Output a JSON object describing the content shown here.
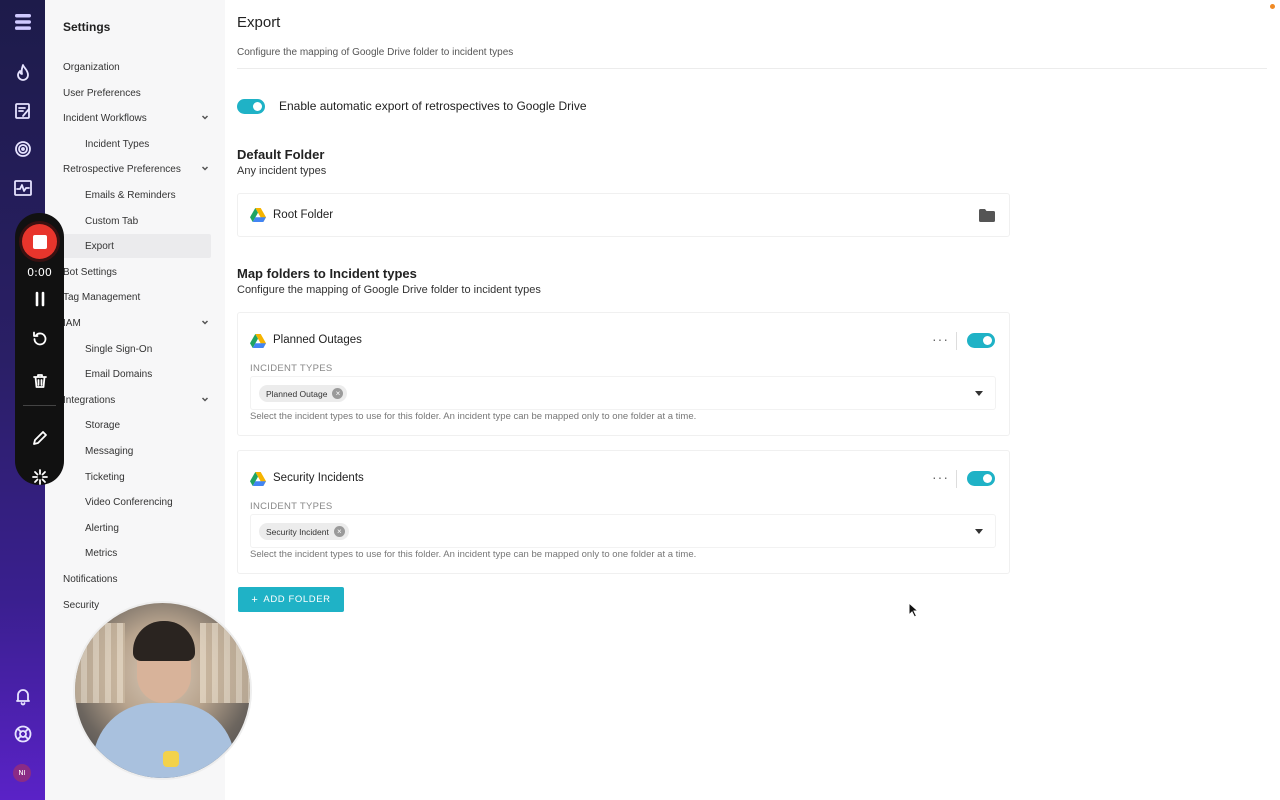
{
  "sidebar": {
    "title": "Settings",
    "items": [
      {
        "label": "Organization",
        "level": 1
      },
      {
        "label": "User Preferences",
        "level": 1
      },
      {
        "label": "Incident Workflows",
        "level": 1,
        "expanded": true
      },
      {
        "label": "Incident Types",
        "level": 2
      },
      {
        "label": "Retrospective Preferences",
        "level": 1,
        "expanded": true
      },
      {
        "label": "Emails & Reminders",
        "level": 2
      },
      {
        "label": "Custom Tab",
        "level": 2
      },
      {
        "label": "Export",
        "level": 2,
        "active": true
      },
      {
        "label": "Bot Settings",
        "level": 1
      },
      {
        "label": "Tag Management",
        "level": 1
      },
      {
        "label": "IAM",
        "level": 1,
        "expanded": true
      },
      {
        "label": "Single Sign-On",
        "level": 2
      },
      {
        "label": "Email Domains",
        "level": 2
      },
      {
        "label": "Integrations",
        "level": 1,
        "expanded": true
      },
      {
        "label": "Storage",
        "level": 2
      },
      {
        "label": "Messaging",
        "level": 2
      },
      {
        "label": "Ticketing",
        "level": 2
      },
      {
        "label": "Video Conferencing",
        "level": 2
      },
      {
        "label": "Alerting",
        "level": 2
      },
      {
        "label": "Metrics",
        "level": 2
      },
      {
        "label": "Notifications",
        "level": 1
      },
      {
        "label": "Security",
        "level": 1
      }
    ]
  },
  "rail": {
    "avatar_initials": "NI",
    "icons": [
      "logo-icon",
      "fire-icon",
      "edit-doc-icon",
      "target-icon",
      "activity-icon",
      "bell-icon",
      "help-circle-icon"
    ]
  },
  "recorder": {
    "time": "0:00"
  },
  "main": {
    "title": "Export",
    "subtitle": "Configure the mapping of Google Drive folder to incident types",
    "enable_label": "Enable automatic export of retrospectives to Google Drive",
    "enable_on": true,
    "default_folder": {
      "heading": "Default Folder",
      "subheading": "Any incident types",
      "folder_name": "Root Folder"
    },
    "map_section": {
      "heading": "Map folders to Incident types",
      "subheading": "Configure the mapping of Google Drive folder to incident types"
    },
    "mappings": [
      {
        "folder_name": "Planned Outages",
        "enabled": true,
        "types_label": "INCIDENT TYPES",
        "chips": [
          "Planned Outage"
        ],
        "helper": "Select the incident types to use for this folder. An incident type can be mapped only to one folder at a time."
      },
      {
        "folder_name": "Security Incidents",
        "enabled": true,
        "types_label": "INCIDENT TYPES",
        "chips": [
          "Security Incident"
        ],
        "helper": "Select the incident types to use for this folder. An incident type can be mapped only to one folder at a time."
      }
    ],
    "add_folder_label": "ADD FOLDER"
  },
  "colors": {
    "accent": "#1fb2c6",
    "rail_top": "#1d1b4a",
    "rail_bottom": "#5a22c7",
    "record_red": "#e8352c"
  }
}
